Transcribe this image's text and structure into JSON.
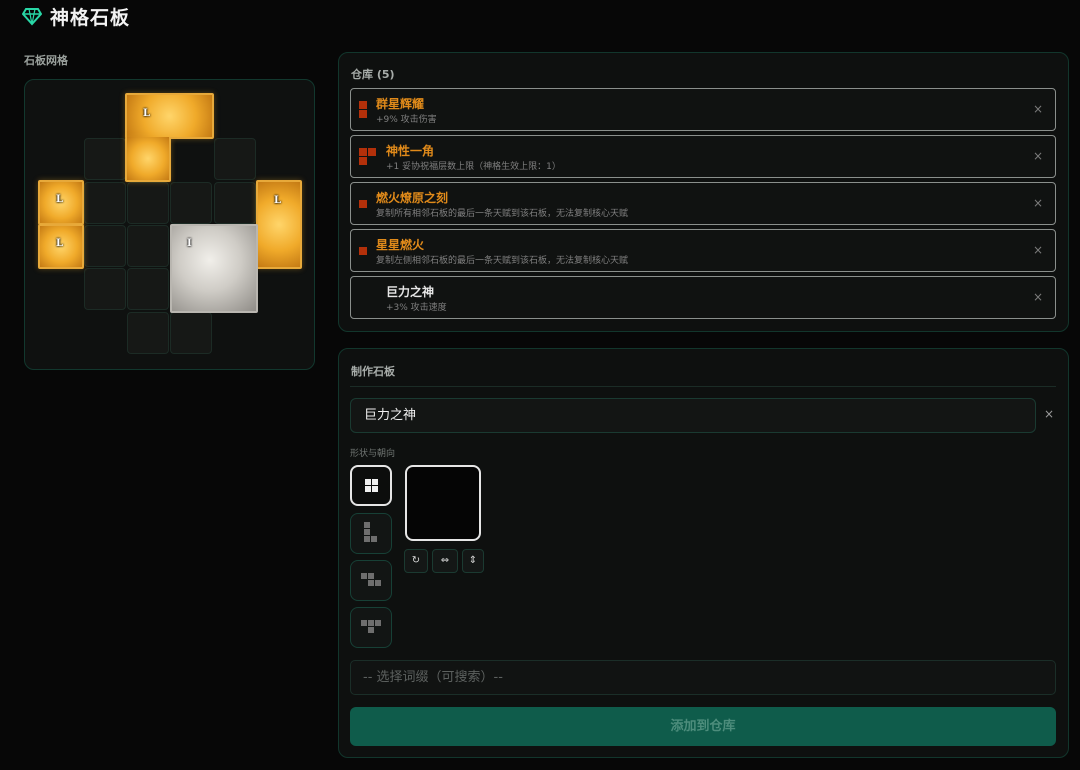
{
  "app": {
    "title": "神格石板",
    "icon": "gem-icon"
  },
  "grid": {
    "label": "石板网格",
    "tile_glyph_gold": "L",
    "tile_glyph_silver": "I"
  },
  "inventory": {
    "title": "仓库 (5)",
    "remove_label": "×",
    "items": [
      {
        "name": "群星辉耀",
        "desc": "+9% 攻击伤害",
        "color": "#e08a1a"
      },
      {
        "name": "神性一角",
        "desc": "+1 妥协祝福层数上限（神格生效上限：1）",
        "color": "#e08a1a"
      },
      {
        "name": "燃火燎原之刻",
        "desc": "复制所有相邻石板的最后一条天赋到该石板，无法复制核心天赋",
        "color": "#e08a1a"
      },
      {
        "name": "星星燃火",
        "desc": "复制左侧相邻石板的最后一条天赋到该石板，无法复制核心天赋",
        "color": "#e08a1a"
      },
      {
        "name": "巨力之神",
        "desc": "+3% 攻击速度",
        "color": "#e6e6e6"
      }
    ]
  },
  "craft": {
    "title": "制作石板",
    "name_value": "巨力之神",
    "clear_label": "×",
    "shape_label": "形状与朝向",
    "tools": {
      "rotate": "↻",
      "flip_h": "⇔",
      "flip_v": "⇕"
    },
    "affix_placeholder": "-- 选择词缀（可搜索）--",
    "add_button": "添加到仓库"
  },
  "colors": {
    "accent": "#0f5c4b",
    "gold": "#f0aa2a",
    "orange_text": "#e08a1a",
    "rune_red": "#b3300a"
  }
}
